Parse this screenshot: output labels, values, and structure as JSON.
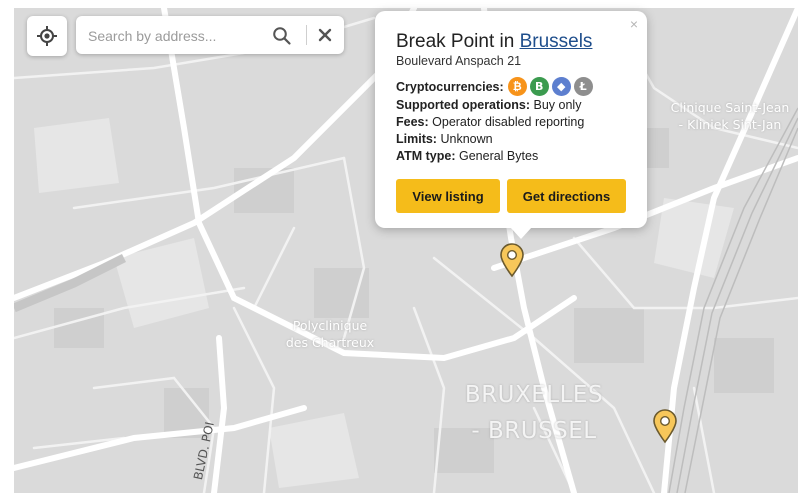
{
  "search": {
    "placeholder": "Search by address..."
  },
  "map": {
    "labels": {
      "hospital_1_line1": "Clinique Saint-Jean",
      "hospital_1_line2": "- Kliniek Sint-Jan",
      "hospital_2_line1": "Polyclinique",
      "hospital_2_line2": "des Chartreux",
      "city_line1": "BRUXELLES",
      "city_line2": "- BRUSSEL",
      "street": "BLVD. POI"
    }
  },
  "popup": {
    "title_prefix": "Break Point in",
    "city_link": "Brussels",
    "address": "Boulevard Anspach 21",
    "cryptocurrencies_label": "Cryptocurrencies:",
    "coins": [
      {
        "name": "bitcoin-icon",
        "glyph": "₿",
        "color": "#f7931a"
      },
      {
        "name": "bitcoin-cash-icon",
        "glyph": "B",
        "color": "#3b9b4f"
      },
      {
        "name": "ethereum-icon",
        "glyph": "◆",
        "color": "#5d7fcf"
      },
      {
        "name": "litecoin-icon",
        "glyph": "Ł",
        "color": "#8e8e8e"
      }
    ],
    "operations_label": "Supported operations:",
    "operations_value": "Buy only",
    "fees_label": "Fees:",
    "fees_value": "Operator disabled reporting",
    "limits_label": "Limits:",
    "limits_value": "Unknown",
    "atm_type_label": "ATM type:",
    "atm_type_value": "General Bytes",
    "view_listing": "View listing",
    "get_directions": "Get directions",
    "close_glyph": "×"
  },
  "colors": {
    "accent": "#f5bc1a",
    "link": "#1f4e8c",
    "map_background": "#d9d9d9",
    "road": "#ffffff",
    "marker_fill": "#f7c75a"
  }
}
